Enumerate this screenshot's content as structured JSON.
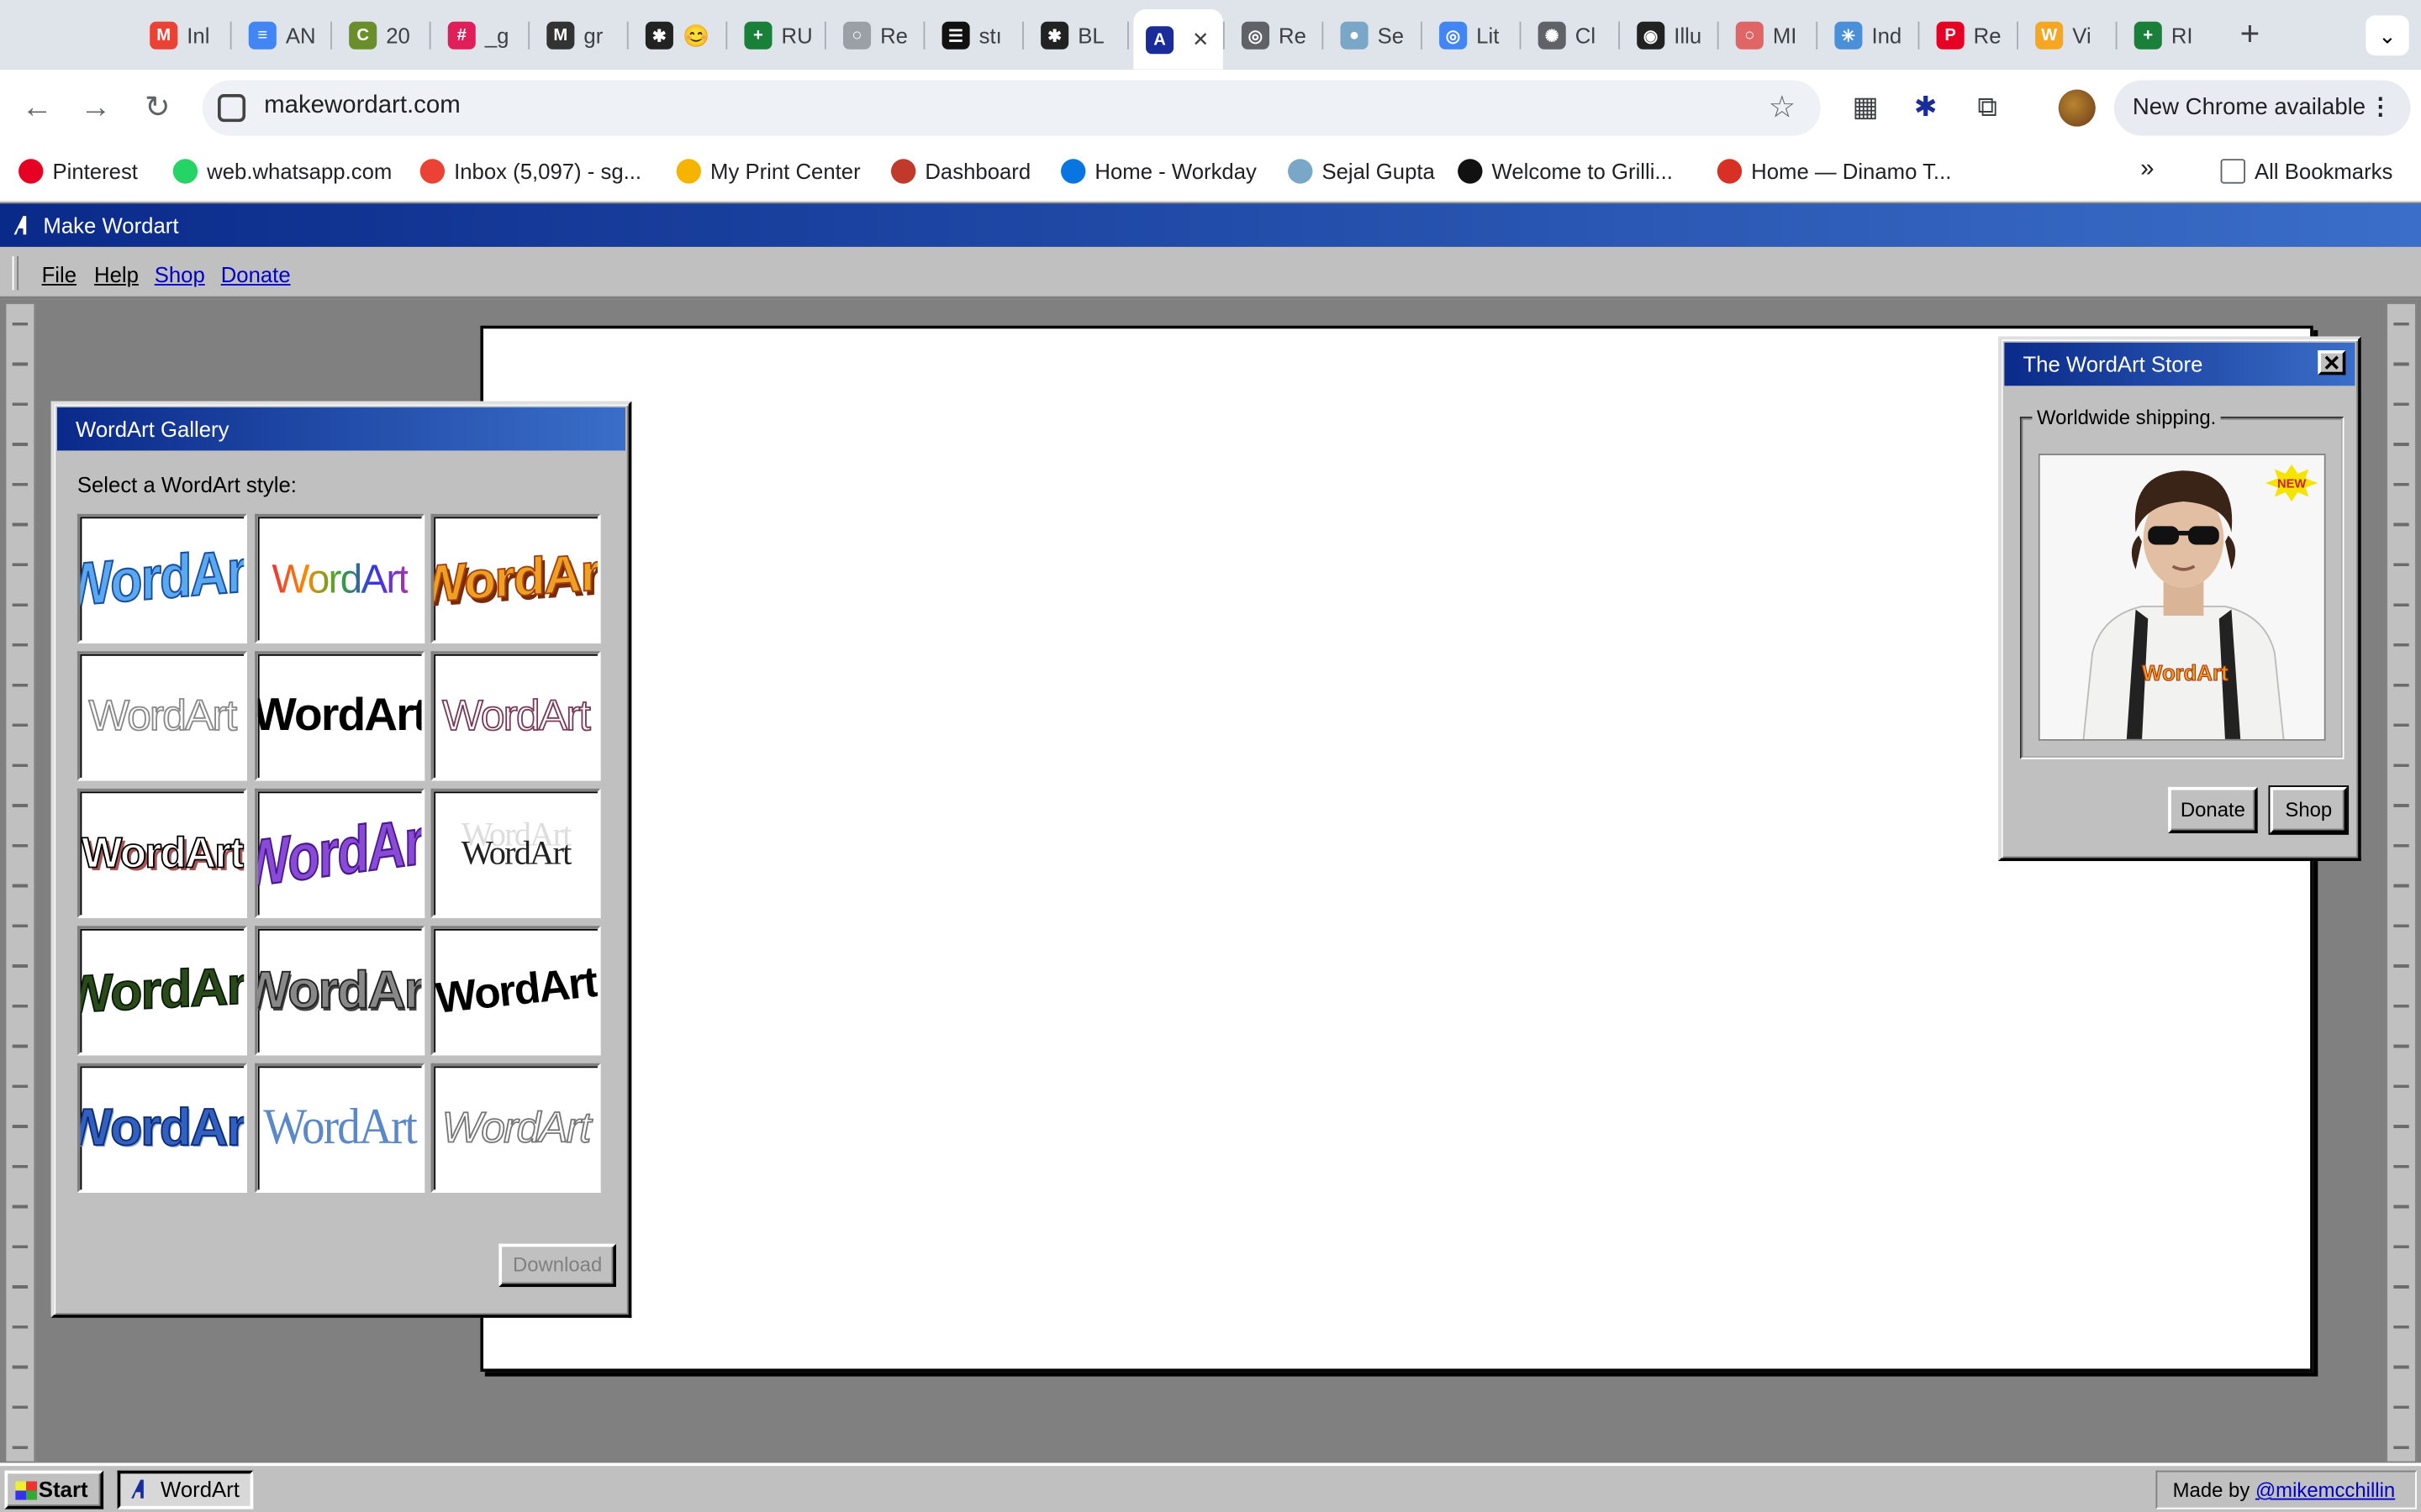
{
  "browser": {
    "tabs": [
      {
        "label": "Inl",
        "color": "#ea4335",
        "glyph": "M"
      },
      {
        "label": "AN",
        "color": "#4285f4",
        "glyph": "≡"
      },
      {
        "label": "20",
        "color": "#6a8f2a",
        "glyph": "C"
      },
      {
        "label": "_g",
        "color": "#e01e5a",
        "glyph": "#"
      },
      {
        "label": "gr",
        "color": "#333333",
        "glyph": "M"
      },
      {
        "label": "😊",
        "color": "#222222",
        "glyph": "✱"
      },
      {
        "label": "RU",
        "color": "#188038",
        "glyph": "+"
      },
      {
        "label": "Re",
        "color": "#9aa0a6",
        "glyph": "○"
      },
      {
        "label": "stı",
        "color": "#111111",
        "glyph": "☰"
      },
      {
        "label": "BL",
        "color": "#222222",
        "glyph": "✱"
      },
      {
        "label": "",
        "color": "#1a2b9a",
        "glyph": "A",
        "active": true
      },
      {
        "label": "Re",
        "color": "#5f6368",
        "glyph": "◎"
      },
      {
        "label": "Se",
        "color": "#7aa7c7",
        "glyph": "●"
      },
      {
        "label": "Lit",
        "color": "#4285f4",
        "glyph": "◎"
      },
      {
        "label": "Cl",
        "color": "#5f6368",
        "glyph": "✺"
      },
      {
        "label": "Illu",
        "color": "#222222",
        "glyph": "◉"
      },
      {
        "label": "MI",
        "color": "#e06666",
        "glyph": "○"
      },
      {
        "label": "Ind",
        "color": "#4a90d9",
        "glyph": "✳"
      },
      {
        "label": "Re",
        "color": "#e60023",
        "glyph": "P"
      },
      {
        "label": "Vi",
        "color": "#f5a623",
        "glyph": "W"
      },
      {
        "label": "RI",
        "color": "#188038",
        "glyph": "+"
      }
    ],
    "url": "makewordart.com",
    "new_chrome_label": "New Chrome available",
    "bookmarks": [
      {
        "label": "Pinterest",
        "color": "#e60023"
      },
      {
        "label": "web.whatsapp.com",
        "color": "#25d366"
      },
      {
        "label": "Inbox (5,097) - sg...",
        "color": "#ea4335"
      },
      {
        "label": "My Print Center",
        "color": "#f4b400"
      },
      {
        "label": "Dashboard",
        "color": "#c0392b"
      },
      {
        "label": "Home - Workday",
        "color": "#0875e1"
      },
      {
        "label": "Sejal Gupta",
        "color": "#7aa7c7"
      },
      {
        "label": "Welcome to Grilli...",
        "color": "#111111"
      },
      {
        "label": "Home — Dinamo T...",
        "color": "#d93025"
      }
    ],
    "all_bookmarks_label": "All Bookmarks"
  },
  "app": {
    "title": "Make Wordart",
    "menu": {
      "file": "File",
      "help": "Help",
      "shop": "Shop",
      "donate": "Donate"
    }
  },
  "gallery": {
    "title": "WordArt Gallery",
    "prompt": "Select a WordArt style:",
    "tile_text": "WordArt",
    "download_label": "Download"
  },
  "store": {
    "title": "The WordArt Store",
    "legend": "Worldwide shipping.",
    "badge": "NEW",
    "shirt_text": "WordArt",
    "donate_label": "Donate",
    "shop_label": "Shop"
  },
  "taskbar": {
    "start_label": "Start",
    "task_label": "WordArt",
    "made_by_prefix": "Made by",
    "made_by_handle": "@mikemcchillin"
  }
}
